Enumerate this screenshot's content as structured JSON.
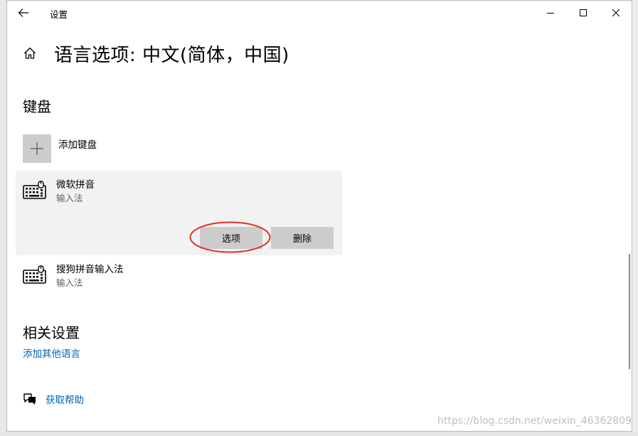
{
  "window": {
    "title": "设置"
  },
  "header": {
    "page_title": "语言选项: 中文(简体，中国)"
  },
  "keyboard_section": {
    "heading": "键盘",
    "add_keyboard_label": "添加键盘",
    "keyboards": [
      {
        "name": "微软拼音",
        "type": "输入法",
        "options_label": "选项",
        "delete_label": "删除"
      },
      {
        "name": "搜狗拼音输入法",
        "type": "输入法"
      }
    ]
  },
  "related_section": {
    "heading": "相关设置",
    "add_language_link": "添加其他语言"
  },
  "help": {
    "label": "获取帮助"
  },
  "watermark": "https://blog.csdn.net/weixin_46362809",
  "icons": {
    "back": "back-arrow-icon",
    "home": "home-icon",
    "minimize": "minimize-icon",
    "maximize": "maximize-icon",
    "close": "close-icon",
    "add": "plus-icon",
    "keyboard": "keyboard-icon",
    "help": "help-chat-icon"
  },
  "colors": {
    "accent_link": "#0063b1",
    "highlight_ellipse": "#e0332b",
    "button_bg": "#cccccc",
    "card_bg": "#f2f2f2"
  }
}
